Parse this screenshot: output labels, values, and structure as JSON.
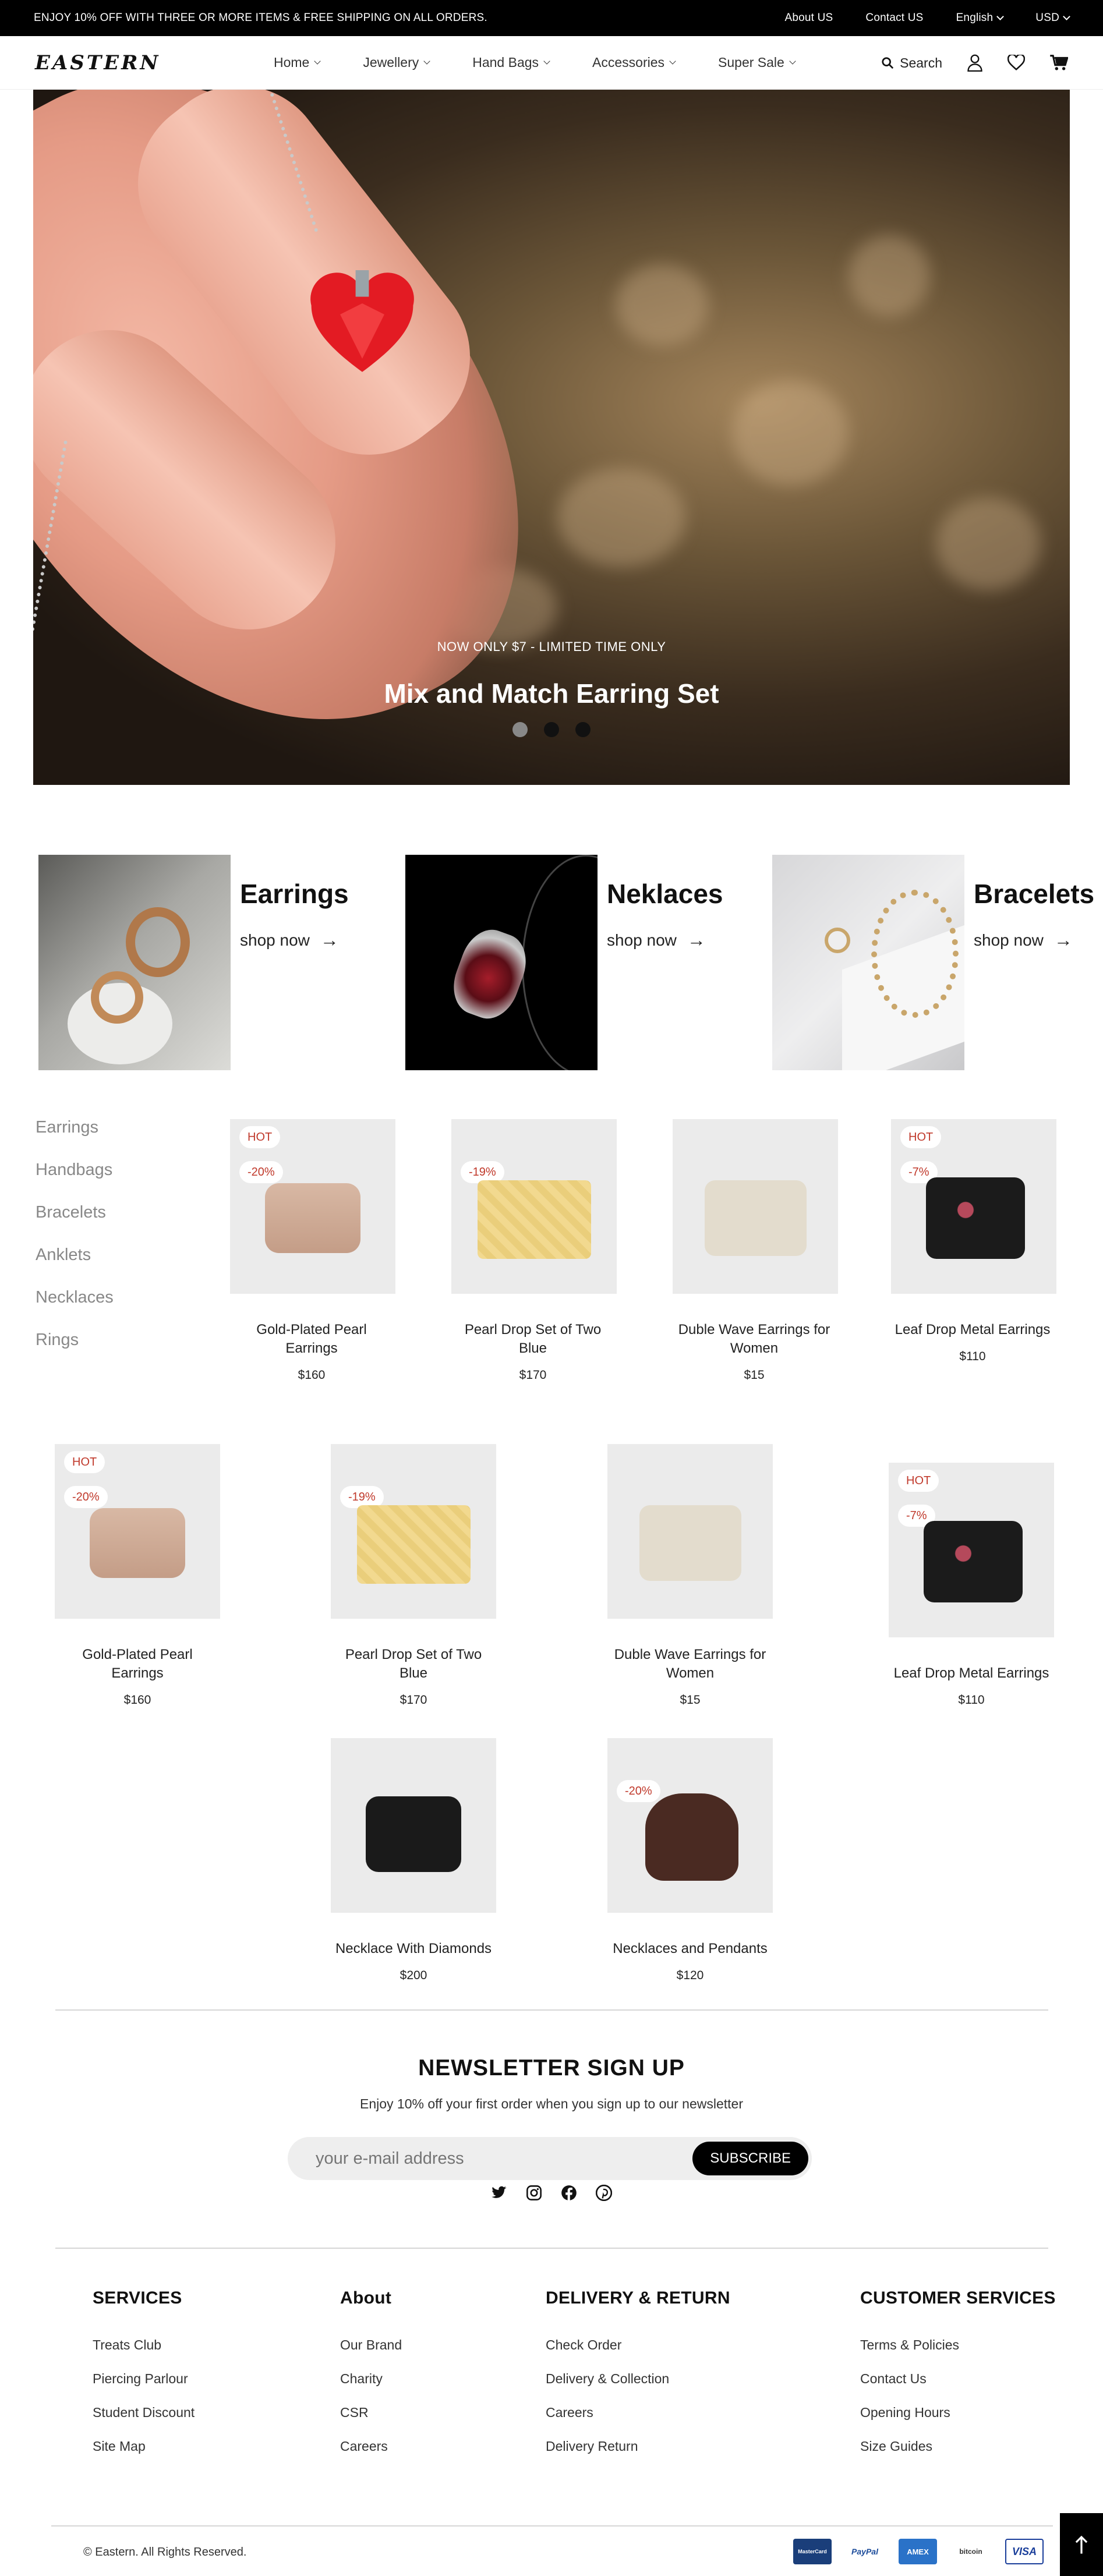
{
  "topbar": {
    "promo": "ENJOY 10% OFF WITH THREE OR MORE ITEMS & FREE SHIPPING ON ALL ORDERS.",
    "about": "About US",
    "contact": "Contact US",
    "language": "English",
    "currency": "USD"
  },
  "header": {
    "logo": "EASTERN",
    "nav": [
      "Home",
      "Jewellery",
      "Hand Bags",
      "Accessories",
      "Super Sale"
    ],
    "search": "Search"
  },
  "hero": {
    "subtitle": "NOW ONLY $7 - LIMITED TIME ONLY",
    "title": "Mix and Match Earring Set",
    "slides": 3,
    "active_slide": 1
  },
  "categories": [
    {
      "name": "Earrings",
      "cta": "shop now"
    },
    {
      "name": "Neklaces",
      "cta": "shop now"
    },
    {
      "name": "Bracelets",
      "cta": "shop now"
    }
  ],
  "filters": [
    "Earrings",
    "Handbags",
    "Bracelets",
    "Anklets",
    "Necklaces",
    "Rings"
  ],
  "products_row1": [
    {
      "name": "Gold-Plated Pearl Earrings",
      "price": "$160",
      "hot": "HOT",
      "discount": "-20%"
    },
    {
      "name": "Pearl Drop Set of Two Blue",
      "price": "$170",
      "discount": "-19%"
    },
    {
      "name": "Duble Wave Earrings for Women",
      "price": "$15"
    },
    {
      "name": "Leaf Drop Metal Earrings",
      "price": "$110",
      "hot": "HOT",
      "discount": "-7%"
    }
  ],
  "products_row2": [
    {
      "name": "Gold-Plated Pearl Earrings",
      "price": "$160",
      "hot": "HOT",
      "discount": "-20%"
    },
    {
      "name": "Pearl Drop Set of Two Blue",
      "price": "$170",
      "discount": "-19%"
    },
    {
      "name": "Duble Wave Earrings for Women",
      "price": "$15"
    },
    {
      "name": "Leaf Drop Metal Earrings",
      "price": "$110",
      "hot": "HOT",
      "discount": "-7%"
    }
  ],
  "products_row3": [
    {
      "name": "Necklace With Diamonds",
      "price": "$200"
    },
    {
      "name": "Necklaces and Pendants",
      "price": "$120",
      "discount": "-20%"
    }
  ],
  "newsletter": {
    "title": "NEWSLETTER SIGN UP",
    "subtitle": "Enjoy 10% off your first order when you sign up to our newsletter",
    "placeholder": "your e-mail address",
    "button": "SUBSCRIBE"
  },
  "footer": {
    "columns": [
      {
        "title": "SERVICES",
        "links": [
          "Treats Club",
          "Piercing Parlour",
          "Student Discount",
          "Site Map"
        ]
      },
      {
        "title": "About",
        "links": [
          "Our Brand",
          "Charity",
          "CSR",
          "Careers"
        ]
      },
      {
        "title": "DELIVERY & RETURN",
        "links": [
          "Check Order",
          "Delivery & Collection",
          "Careers",
          "Delivery Return"
        ]
      },
      {
        "title": "CUSTOMER SERVICES",
        "links": [
          "Terms & Policies",
          "Contact Us",
          "Opening Hours",
          "Size Guides"
        ]
      }
    ],
    "copyright": "© Eastern. All Rights Reserved.",
    "payments": [
      "MasterCard",
      "PayPal",
      "AMEX",
      "bitcoin",
      "VISA"
    ]
  },
  "colors": {
    "badge": "#c0392b",
    "topbar": "#000000",
    "card_bg": "#ebebeb"
  }
}
